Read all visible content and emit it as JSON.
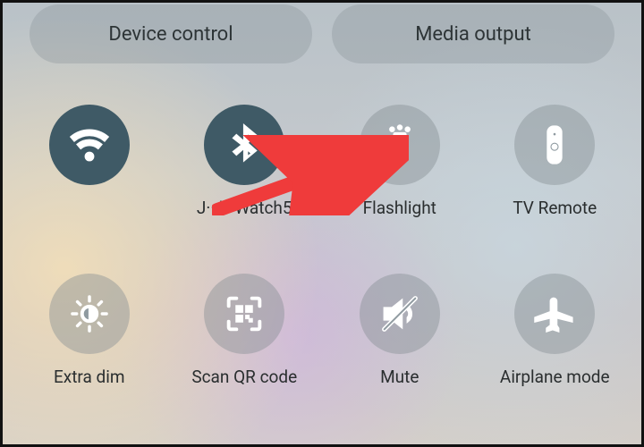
{
  "top": {
    "device_control": "Device control",
    "media_output": "Media output"
  },
  "tiles": {
    "wifi": {
      "label": "",
      "active": true
    },
    "bluetooth": {
      "label": "J···'s Watch5",
      "active": true
    },
    "flashlight": {
      "label": "Flashlight",
      "active": false
    },
    "tv_remote": {
      "label": "TV Remote",
      "active": false
    },
    "extra_dim": {
      "label": "Extra dim",
      "active": false
    },
    "scan_qr": {
      "label": "Scan QR code",
      "active": false
    },
    "mute": {
      "label": "Mute",
      "active": false
    },
    "airplane": {
      "label": "Airplane mode",
      "active": false
    }
  },
  "colors": {
    "active_bg": "#3f5a66",
    "inactive_bg": "rgba(130,140,145,0.42)",
    "annotation": "#ef3b3b"
  }
}
